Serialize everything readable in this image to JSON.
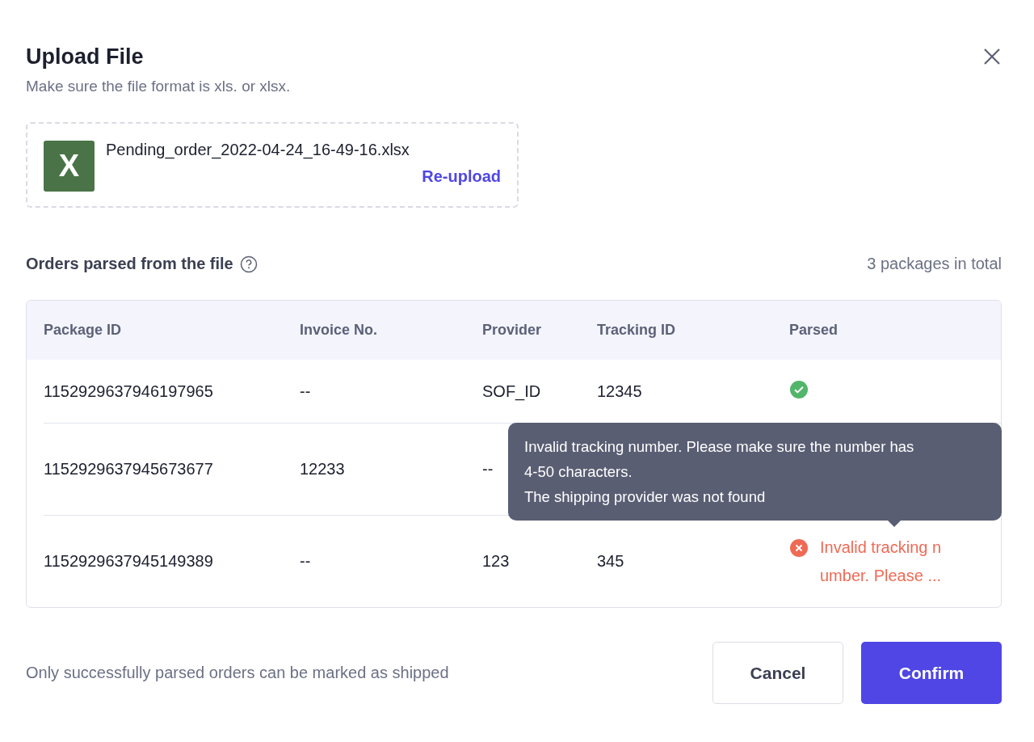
{
  "dialog": {
    "title": "Upload File",
    "subtitle": "Make sure the file format is xls. or xlsx."
  },
  "file": {
    "icon_letter": "X",
    "name": "Pending_order_2022-04-24_16-49-16.xlsx",
    "action": "Re-upload"
  },
  "section": {
    "title": "Orders parsed from the file",
    "total": "3 packages in total"
  },
  "table": {
    "columns": [
      "Package ID",
      "Invoice No.",
      "Provider",
      "Tracking ID",
      "Parsed"
    ],
    "rows": [
      {
        "package_id": "1152929637946197965",
        "invoice": "--",
        "provider": "SOF_ID",
        "tracking_id": "12345",
        "parsed": {
          "kind": "ok"
        }
      },
      {
        "package_id": "1152929637945673677",
        "invoice": "12233",
        "provider": "--"
      },
      {
        "package_id": "1152929637945149389",
        "invoice": "--",
        "provider": "123",
        "tracking_id": "345",
        "parsed": {
          "kind": "error",
          "message": "Invalid tracking number. Please ..."
        }
      }
    ]
  },
  "tooltip": {
    "lines": [
      "Invalid tracking number. Please make sure the number has 4-50 characters.",
      "The shipping provider was not found"
    ]
  },
  "footer": {
    "note": "Only successfully parsed orders can be marked as shipped",
    "buttons": [
      {
        "label": "Cancel",
        "kind": "secondary"
      },
      {
        "label": "Confirm",
        "kind": "primary"
      }
    ]
  }
}
